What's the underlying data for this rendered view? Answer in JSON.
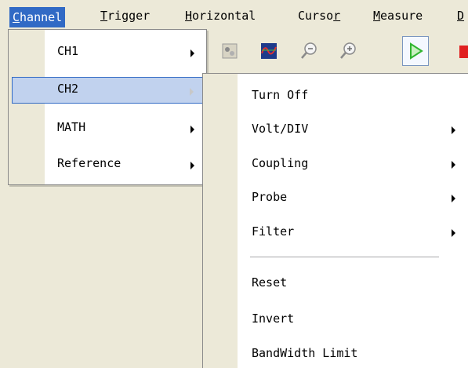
{
  "menubar": {
    "items": [
      {
        "first": "C",
        "rest": "hannel"
      },
      {
        "first": "T",
        "rest": "rigger"
      },
      {
        "first": "H",
        "rest": "orizontal"
      },
      {
        "first": "Curso",
        "rest": "r"
      },
      {
        "first": "M",
        "rest": "easure"
      },
      {
        "first": "D",
        "rest": ""
      }
    ]
  },
  "channel_menu": {
    "items": [
      {
        "label": "CH1",
        "has_submenu": true
      },
      {
        "label": "CH2",
        "has_submenu": true,
        "selected": true
      },
      {
        "label": "MATH",
        "has_submenu": true
      },
      {
        "label": "Reference",
        "has_submenu": true
      }
    ]
  },
  "ch2_submenu": {
    "items": [
      {
        "label": "Turn Off",
        "has_submenu": false
      },
      {
        "label": "Volt/DIV",
        "has_submenu": true
      },
      {
        "label": "Coupling",
        "has_submenu": true
      },
      {
        "label": "Probe",
        "has_submenu": true
      },
      {
        "label": "Filter",
        "has_submenu": true
      },
      {
        "label": "Reset",
        "has_submenu": false
      },
      {
        "label": "Invert",
        "has_submenu": false
      },
      {
        "label": "BandWidth Limit",
        "has_submenu": false
      }
    ]
  },
  "toolbar": {
    "icons": [
      "probe-icon",
      "waveform-icon",
      "zoom-out-icon",
      "zoom-in-icon",
      "run-icon",
      "stop-icon"
    ]
  },
  "colors": {
    "selection": "#316ac5",
    "menu_highlight": "#c1d2ee",
    "chrome": "#ece9d8",
    "run_green": "#2fb52f",
    "stop_red": "#e02020"
  }
}
